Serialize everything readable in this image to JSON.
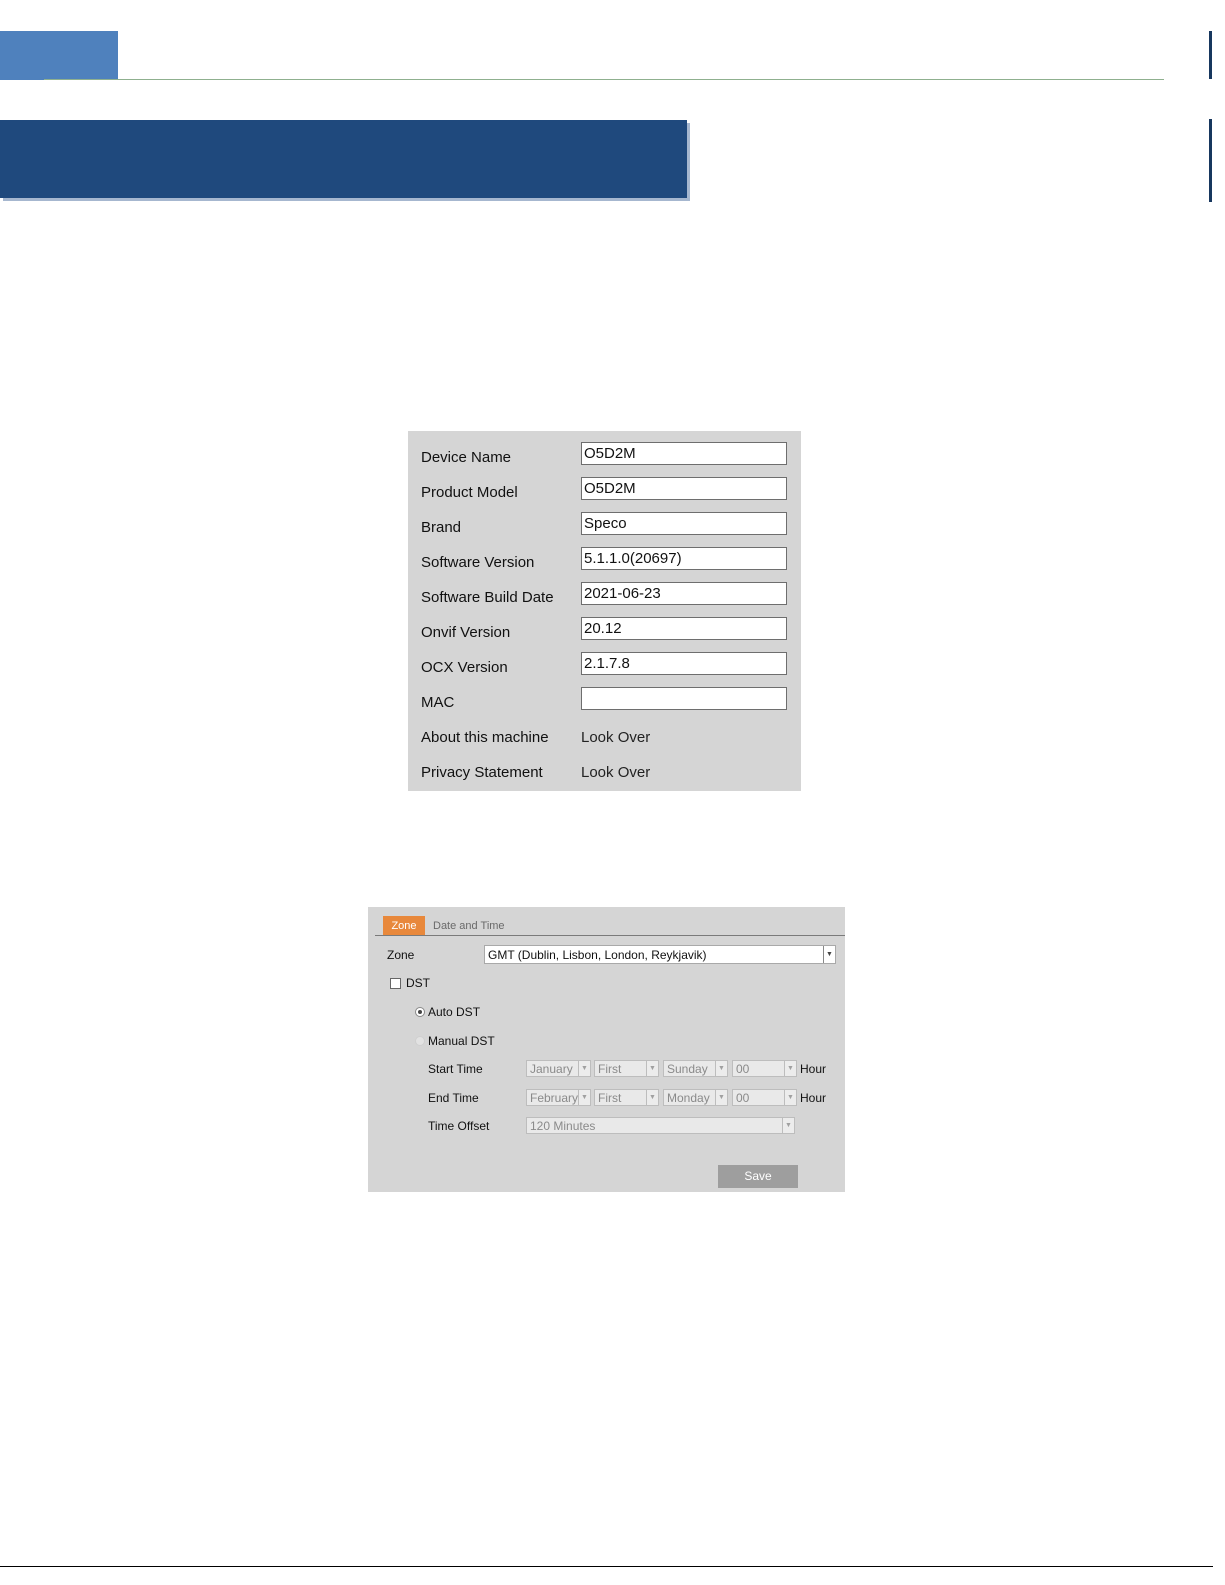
{
  "device_info": {
    "rows": [
      {
        "label": "Device Name",
        "value": "O5D2M"
      },
      {
        "label": "Product Model",
        "value": "O5D2M"
      },
      {
        "label": "Brand",
        "value": "Speco"
      },
      {
        "label": "Software Version",
        "value": "5.1.1.0(20697)"
      },
      {
        "label": "Software Build Date",
        "value": "2021-06-23"
      },
      {
        "label": "Onvif Version",
        "value": "20.12"
      },
      {
        "label": "OCX Version",
        "value": "2.1.7.8"
      },
      {
        "label": "MAC",
        "value": ""
      }
    ],
    "about": {
      "label": "About this machine",
      "link": "Look Over"
    },
    "privacy": {
      "label": "Privacy Statement",
      "link": "Look Over"
    }
  },
  "time_settings": {
    "tabs": {
      "active": "Zone",
      "other": "Date and Time"
    },
    "zone": {
      "label": "Zone",
      "value": "GMT (Dublin, Lisbon, London, Reykjavik)"
    },
    "dst": {
      "label": "DST",
      "checked": false
    },
    "auto_dst": {
      "label": "Auto DST",
      "selected": true
    },
    "manual_dst": {
      "label": "Manual DST",
      "selected": false
    },
    "start_time": {
      "label": "Start Time",
      "month": "January",
      "week": "First",
      "day": "Sunday",
      "hour": "00",
      "unit": "Hour"
    },
    "end_time": {
      "label": "End Time",
      "month": "February",
      "week": "First",
      "day": "Monday",
      "hour": "00",
      "unit": "Hour"
    },
    "time_offset": {
      "label": "Time Offset",
      "value": "120 Minutes"
    },
    "save_label": "Save"
  },
  "colors": {
    "banner": "#1f497d",
    "tab_block": "#4f81bd",
    "active_tab": "#e8883b",
    "panel_bg": "#d5d5d5"
  }
}
